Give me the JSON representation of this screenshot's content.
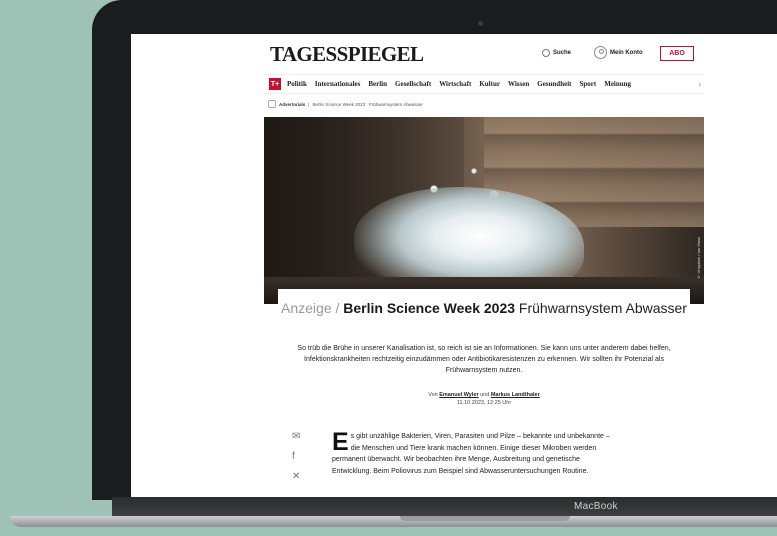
{
  "device": {
    "label": "MacBook"
  },
  "site": {
    "logo": "TAGESSPIEGEL",
    "search_label": "Suche",
    "account_label": "Mein Konto",
    "abo_label": "ABO"
  },
  "nav": {
    "tplus": "T+",
    "items": [
      "Politik",
      "Internationales",
      "Berlin",
      "Gesellschaft",
      "Wirtschaft",
      "Kultur",
      "Wissen",
      "Gesundheit",
      "Sport",
      "Meinung"
    ]
  },
  "breadcrumb": {
    "section": "Advertorials",
    "separator": "|",
    "page": "Berlin Science Week 2023 : Frühwarnsystem Abwasser"
  },
  "hero": {
    "credit": "© Unsplash / Ian Wass"
  },
  "article": {
    "kicker": "Anzeige /",
    "kicker_title": "Berlin Science Week 2023",
    "title": "Frühwarnsystem Abwasser",
    "teaser": "So trüb die Brühe in unserer Kanalisation ist, so reich ist sie an Informationen. Sie kann uns unter anderem dabei helfen, Infektionskrankheiten rechtzeitig einzudämmen oder Antibiotikaresistenzen zu erkennen. Wir sollten ihr Potenzial als Frühwarnsystem nutzen.",
    "byline_prefix": "Von",
    "author_1": "Emanuel Wyler",
    "byline_and": "und",
    "author_2": "Markus Landthaler",
    "date": "11.10.2023, 12:25 Uhr",
    "dropcap": "E",
    "body": "s gibt unzählige Bakterien, Viren, Parasiten und Pilze – bekannte und unbekannte – die Menschen und Tiere krank machen können. Einige dieser Mikroben werden permanent überwacht. Wir beobachten ihre Menge, Ausbreitung und genetische Entwicklung. Beim Poliovirus zum Beispiel sind Abwasseruntersuchungen Routine."
  },
  "share": {
    "mail_icon": "mail-icon",
    "facebook_icon": "facebook-icon",
    "x_icon": "x-icon"
  },
  "colors": {
    "brand_red": "#c8102e",
    "background": "#9ec2b6"
  }
}
